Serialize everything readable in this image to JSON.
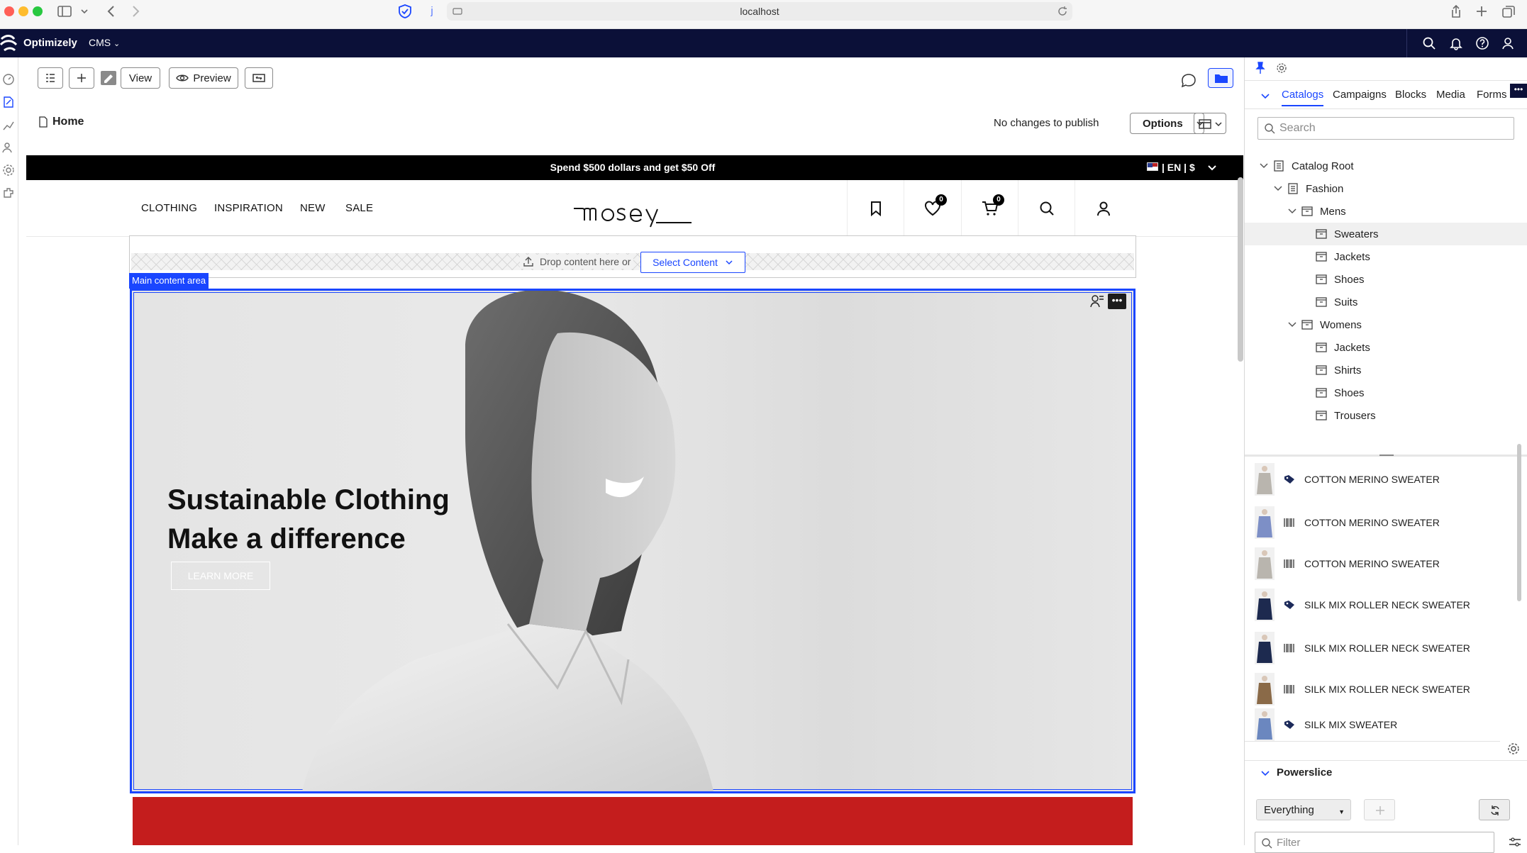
{
  "browser": {
    "url": "localhost"
  },
  "cms": {
    "brand": "Optimizely",
    "product_menu": "CMS"
  },
  "toolbar": {
    "view_label": "View",
    "preview_label": "Preview",
    "page_title": "Home",
    "publish_status": "No changes to publish",
    "options_label": "Options"
  },
  "site": {
    "promo": "Spend $500 dollars and get $50 Off",
    "locale": "| EN | $",
    "nav": [
      "CLOTHING",
      "INSPIRATION",
      "NEW",
      "SALE"
    ],
    "logo": "mosey",
    "wishlist_count": "0",
    "cart_count": "0",
    "dropzone_text": "Drop content here or",
    "select_content": "Select Content",
    "main_area_label": "Main content area",
    "hero_line1": "Sustainable Clothing",
    "hero_line2": "Make a difference",
    "hero_cta": "LEARN MORE",
    "hero_menu": "•••"
  },
  "panel": {
    "tabs": [
      "Catalogs",
      "Campaigns",
      "Blocks",
      "Media",
      "Forms"
    ],
    "active_tab": "Catalogs",
    "search_placeholder": "Search",
    "tree": [
      {
        "label": "Catalog Root"
      },
      {
        "label": "Fashion"
      },
      {
        "label": "Mens"
      },
      {
        "label": "Sweaters"
      },
      {
        "label": "Jackets"
      },
      {
        "label": "Shoes"
      },
      {
        "label": "Suits"
      },
      {
        "label": "Womens"
      },
      {
        "label": "Jackets"
      },
      {
        "label": "Shirts"
      },
      {
        "label": "Shoes"
      },
      {
        "label": "Trousers"
      }
    ],
    "products": [
      {
        "name": "COTTON MERINO SWEATER",
        "kind": "product-tag-icon",
        "color": "#b9b5ae"
      },
      {
        "name": "COTTON MERINO SWEATER",
        "kind": "barcode-icon",
        "color": "#7d8fc6"
      },
      {
        "name": "COTTON MERINO SWEATER",
        "kind": "barcode-icon",
        "color": "#b9b5ae"
      },
      {
        "name": "SILK MIX ROLLER NECK SWEATER",
        "kind": "product-tag-icon",
        "color": "#1d2a4f"
      },
      {
        "name": "SILK MIX ROLLER NECK SWEATER",
        "kind": "barcode-icon",
        "color": "#1d2a4f"
      },
      {
        "name": "SILK MIX ROLLER NECK SWEATER",
        "kind": "barcode-icon",
        "color": "#8a6a48"
      },
      {
        "name": "SILK MIX SWEATER",
        "kind": "product-tag-icon",
        "color": "#6b87bf"
      }
    ],
    "powerslice_title": "Powerslice",
    "powerslice_select": "Everything",
    "filter_placeholder": "Filter"
  },
  "colors": {
    "accent": "#1a46ff",
    "cms_bar": "#0b1038",
    "promo_bg": "#000000",
    "red_banner": "#c41d1d"
  }
}
